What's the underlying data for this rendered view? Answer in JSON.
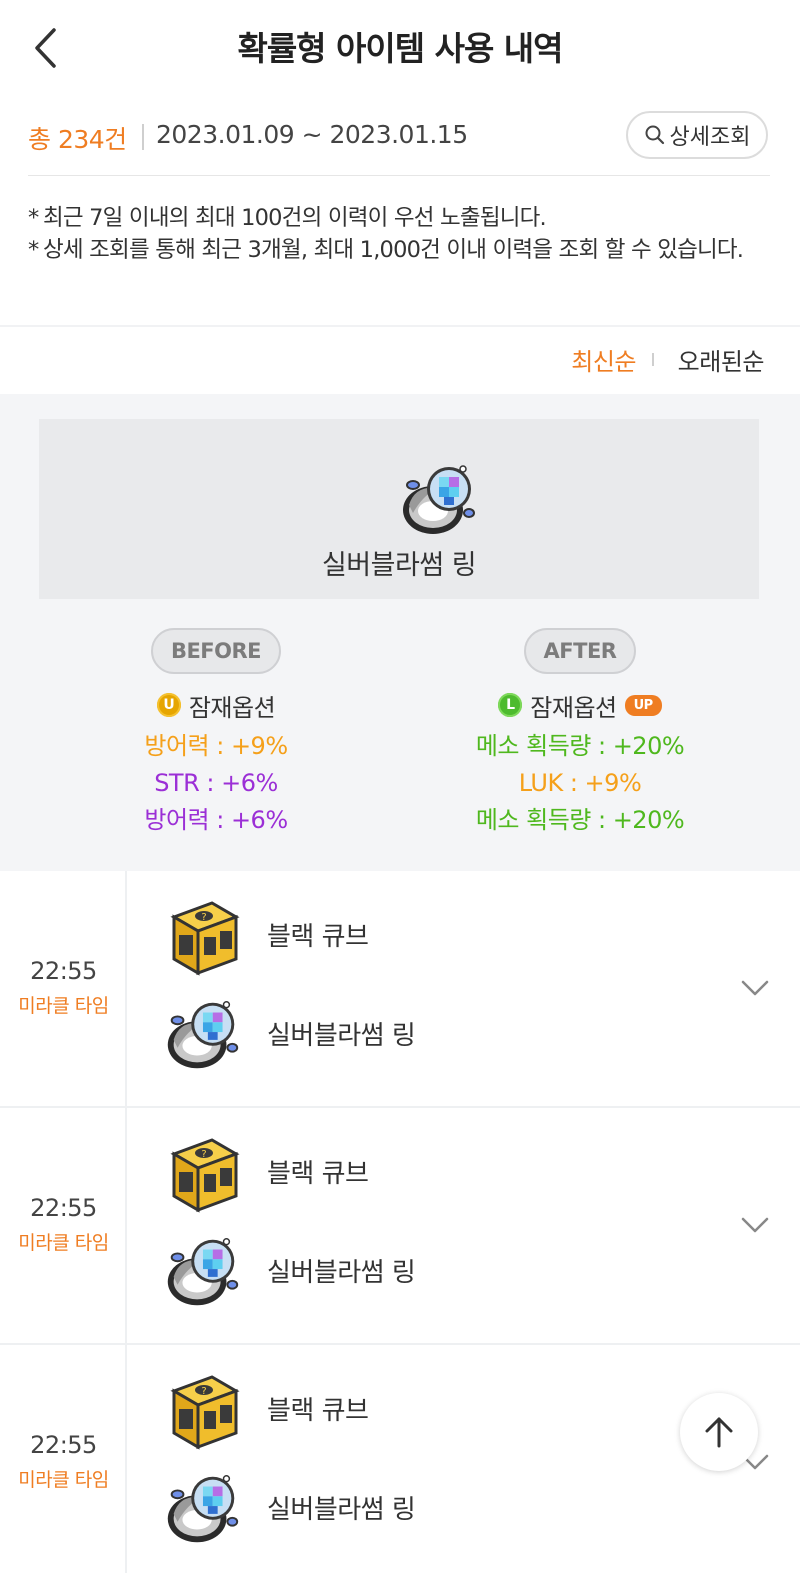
{
  "header": {
    "title": "확률형 아이템 사용 내역"
  },
  "summary": {
    "total": "총 234건",
    "date_range": "2023.01.09 ~ 2023.01.15",
    "detail_button": "상세조회"
  },
  "notes": [
    "최근 7일 이내의 최대 100건의 이력이 우선 노출됩니다.",
    "상세 조회를 통해 최근 3개월, 최대 1,000건 이내 이력을 조회 할 수 있습니다."
  ],
  "sort": {
    "newest": "최신순",
    "oldest": "오래된순"
  },
  "detail": {
    "item_name": "실버블라썸 링",
    "before": {
      "label": "BEFORE",
      "grade_letter": "U",
      "potential_title": "잠재옵션",
      "options": [
        {
          "text": "방어력 : +9%",
          "color": "#f5a01a"
        },
        {
          "text": "STR : +6%",
          "color": "#9b2fd6"
        },
        {
          "text": "방어력 : +6%",
          "color": "#9b2fd6"
        }
      ]
    },
    "after": {
      "label": "AFTER",
      "grade_letter": "L",
      "potential_title": "잠재옵션",
      "up_badge": "UP",
      "options": [
        {
          "text": "메소 획득량 : +20%",
          "color": "#4fb81e"
        },
        {
          "text": "LUK : +9%",
          "color": "#f5a01a"
        },
        {
          "text": "메소 획득량 : +20%",
          "color": "#4fb81e"
        }
      ]
    }
  },
  "records": [
    {
      "time": "22:55",
      "tag": "미라클 타임",
      "cube": "블랙 큐브",
      "item": "실버블라썸 링"
    },
    {
      "time": "22:55",
      "tag": "미라클 타임",
      "cube": "블랙 큐브",
      "item": "실버블라썸 링"
    },
    {
      "time": "22:55",
      "tag": "미라클 타임",
      "cube": "블랙 큐브",
      "item": "실버블라썸 링"
    }
  ],
  "colors": {
    "accent": "#ef7d22",
    "panel_bg": "#f4f5f7"
  },
  "icons": {
    "back": "back-arrow-icon",
    "search": "search-icon",
    "expand": "chevron-down-icon",
    "scroll_top": "arrow-up-icon"
  }
}
